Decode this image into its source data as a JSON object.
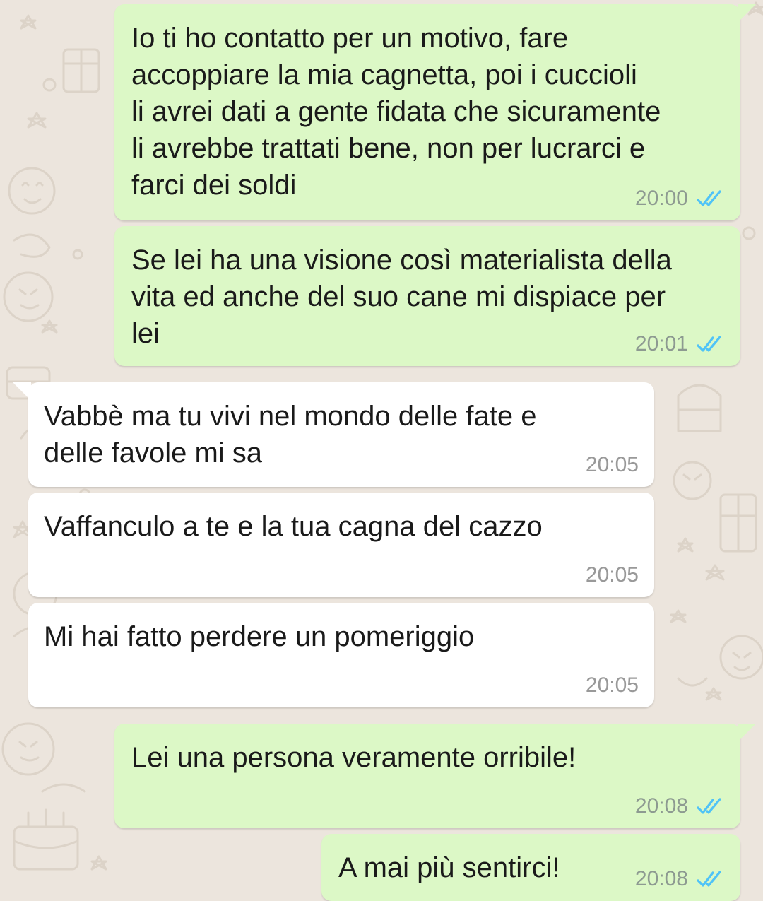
{
  "chat": {
    "colors": {
      "wallpaper": "#ECE5DD",
      "outgoing_bubble": "#DCF8C6",
      "incoming_bubble": "#FFFFFF",
      "read_ticks": "#4FC3F7"
    },
    "messages": [
      {
        "direction": "outgoing",
        "text": "Io ti ho contatto per un motivo, fare\naccoppiare la mia cagnetta, poi i cuccioli\nli avrei dati a gente fidata che sicuramente\nli avrebbe trattati bene, non per lucrarci e\nfarci dei soldi",
        "time": "20:00",
        "status_icon": "double-check-read-icon"
      },
      {
        "direction": "outgoing",
        "text": "Se lei ha una visione così materialista della\nvita ed anche del suo cane mi dispiace per\nlei",
        "time": "20:01",
        "status_icon": "double-check-read-icon"
      },
      {
        "direction": "incoming",
        "text": "Vabbè ma tu vivi nel mondo delle fate e\ndelle favole mi sa",
        "time": "20:05"
      },
      {
        "direction": "incoming",
        "text": "Vaffanculo a te e la tua cagna del cazzo",
        "time": "20:05"
      },
      {
        "direction": "incoming",
        "text": "Mi hai fatto perdere un pomeriggio",
        "time": "20:05"
      },
      {
        "direction": "outgoing",
        "text": "Lei una persona veramente orribile!",
        "time": "20:08",
        "status_icon": "double-check-read-icon"
      },
      {
        "direction": "outgoing",
        "text": "A mai più sentirci!",
        "time": "20:08",
        "status_icon": "double-check-read-icon"
      }
    ]
  }
}
